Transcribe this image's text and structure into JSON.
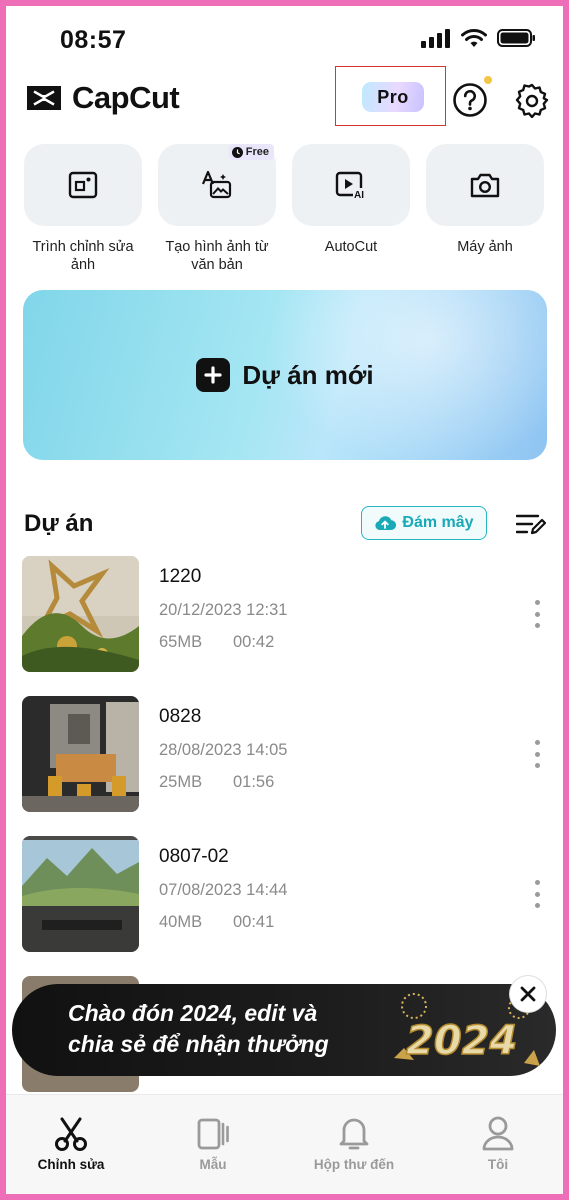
{
  "status_bar": {
    "time": "08:57"
  },
  "header": {
    "app_name": "CapCut",
    "pro_label": "Pro"
  },
  "tools": [
    {
      "label": "Trình chỉnh sửa ảnh",
      "icon": "photo-editor-icon",
      "badge": ""
    },
    {
      "label": "Tạo hình ảnh từ văn bản",
      "icon": "text-to-image-icon",
      "badge": "Free"
    },
    {
      "label": "AutoCut",
      "icon": "autocut-icon",
      "badge": ""
    },
    {
      "label": "Máy ảnh",
      "icon": "camera-icon",
      "badge": ""
    }
  ],
  "new_project": {
    "label": "Dự án mới"
  },
  "projects_section": {
    "title": "Dự án",
    "cloud_label": "Đám mây"
  },
  "projects": [
    {
      "name": "1220",
      "date": "20/12/2023 12:31",
      "size": "65MB",
      "duration": "00:42"
    },
    {
      "name": "0828",
      "date": "28/08/2023 14:05",
      "size": "25MB",
      "duration": "01:56"
    },
    {
      "name": "0807-02",
      "date": "07/08/2023 14:44",
      "size": "40MB",
      "duration": "00:41"
    }
  ],
  "banner": {
    "line1": "Chào đón 2024, edit và",
    "line2": "chia sẻ để nhận thưởng",
    "art_text": "2024"
  },
  "tabs": [
    {
      "label": "Chỉnh sửa",
      "icon": "scissors-icon",
      "active": true
    },
    {
      "label": "Mẫu",
      "icon": "template-icon",
      "active": false
    },
    {
      "label": "Hộp thư đến",
      "icon": "bell-icon",
      "active": false
    },
    {
      "label": "Tôi",
      "icon": "profile-icon",
      "active": false
    }
  ],
  "colors": {
    "accent": "#19a9b7",
    "highlight_box": "#d9352f",
    "notification_dot": "#f3c544",
    "border": "#ee6fb8"
  }
}
